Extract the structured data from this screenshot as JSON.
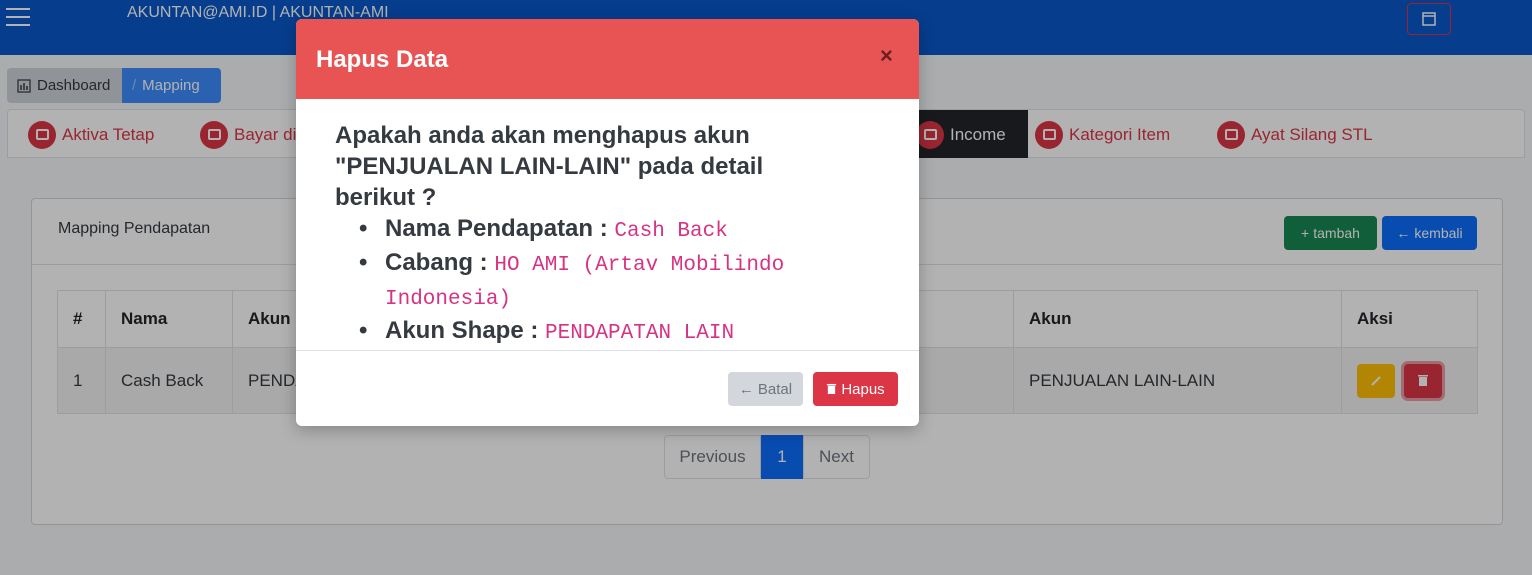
{
  "navbar": {
    "user": "AKUNTAN@AMI.ID | AKUNTAN-AMI"
  },
  "breadcrumb": {
    "dashboard": "Dashboard",
    "mapping": "Mapping"
  },
  "tabs": [
    {
      "label": "Aktiva Tetap"
    },
    {
      "label": "Bayar di"
    },
    {
      "label": "Income"
    },
    {
      "label": "Kategori Item"
    },
    {
      "label": "Ayat Silang STL"
    }
  ],
  "card": {
    "title": "Mapping Pendapatan",
    "add_label": "tambah",
    "back_label": "kembali"
  },
  "table": {
    "headers": [
      "#",
      "Nama",
      "Akun",
      "Akun",
      "Aksi"
    ],
    "rows": [
      {
        "no": "1",
        "nama": "Cash Back",
        "akun_left": "PENDA",
        "akun": "PENJUALAN LAIN-LAIN"
      }
    ]
  },
  "pagination": {
    "prev": "Previous",
    "page": "1",
    "next": "Next"
  },
  "modal": {
    "title": "Hapus Data",
    "close": "×",
    "message": "Apakah anda akan menghapus akun \"PENJUALAN LAIN-LAIN\" pada detail berikut ?",
    "items": [
      {
        "label": "Nama Pendapatan :",
        "value": "Cash Back"
      },
      {
        "label": "Cabang :",
        "value": "HO AMI (Artav Mobilindo Indonesia)"
      },
      {
        "label": "Akun Shape :",
        "value": "PENDAPATAN LAIN"
      }
    ],
    "cancel_label": "Batal",
    "delete_label": "Hapus"
  },
  "colors": {
    "navbar": "#0a58ca",
    "modal_header": "#e85454",
    "danger": "#dc3545",
    "primary": "#0d6efd",
    "success": "#198754",
    "warning": "#ffc107"
  }
}
